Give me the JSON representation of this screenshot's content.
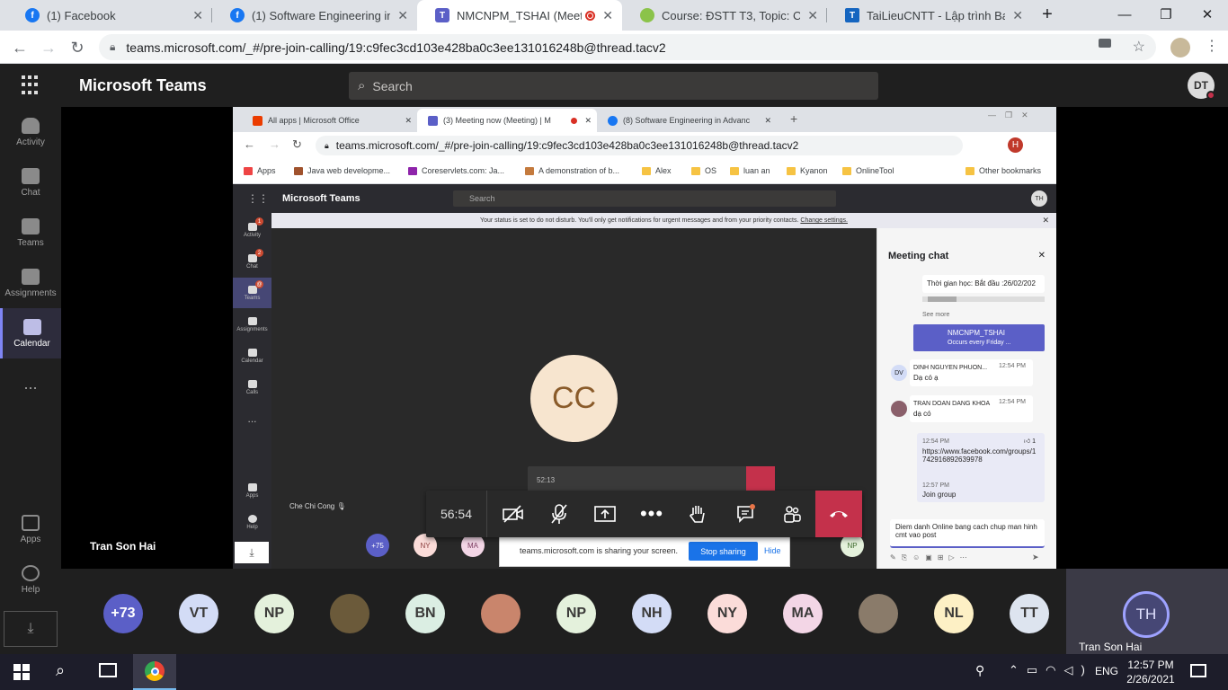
{
  "browser": {
    "tabs": [
      {
        "title": "(1) Facebook"
      },
      {
        "title": "(1) Software Engineering in Ad"
      },
      {
        "title": "NMCNPM_TSHAI (Meeting"
      },
      {
        "title": "Course: ĐSTT T3, Topic: CHUO"
      },
      {
        "title": "TaiLieuCNTT - Lập trình Backen"
      }
    ],
    "url": "teams.microsoft.com/_#/pre-join-calling/19:c9fec3cd103e428ba0c3ee131016248b@thread.tacv2"
  },
  "teams": {
    "app_title": "Microsoft Teams",
    "search_placeholder": "Search",
    "user_initials": "DT",
    "rail": [
      {
        "label": "Activity"
      },
      {
        "label": "Chat"
      },
      {
        "label": "Teams"
      },
      {
        "label": "Assignments"
      },
      {
        "label": "Calendar"
      },
      {
        "label": "..."
      }
    ],
    "rail_bottom": [
      {
        "label": "Apps"
      },
      {
        "label": "Help"
      }
    ],
    "presenter_name": "Tran Son Hai",
    "self_name": "Tran Son Hai",
    "self_initials": "TH"
  },
  "shared": {
    "tabs": [
      {
        "title": "All apps | Microsoft Office"
      },
      {
        "title": "(3) Meeting now (Meeting) | M"
      },
      {
        "title": "(8) Software Engineering in Advanc"
      }
    ],
    "url": "teams.microsoft.com/_#/pre-join-calling/19:c9fec3cd103e428ba0c3ee131016248b@thread.tacv2",
    "bookmarks": [
      "Apps",
      "Java web developme...",
      "Coreservlets.com: Ja...",
      "A demonstration of b...",
      "Alex",
      "OS",
      "luan an",
      "Kyanon",
      "OnlineTool"
    ],
    "other_bookmarks": "Other bookmarks",
    "app_title": "Microsoft Teams",
    "search": "Search",
    "user_initials": "TH",
    "profile_initial": "H",
    "rail": [
      {
        "label": "Activity",
        "badge": "1"
      },
      {
        "label": "Chat",
        "badge": "2"
      },
      {
        "label": "Teams",
        "badge": "@"
      },
      {
        "label": "Assignments",
        "badge": ""
      },
      {
        "label": "Calendar",
        "badge": ""
      },
      {
        "label": "Calls",
        "badge": ""
      },
      {
        "label": "...",
        "badge": ""
      }
    ],
    "rail_bottom": [
      {
        "label": "Apps"
      },
      {
        "label": "Help"
      }
    ],
    "dnd_text": "Your status is set to do not disturb. You'll only get notifications for urgent messages and from your priority contacts.",
    "dnd_link": "Change settings.",
    "speaker_initials": "CC",
    "speaker_name": "Che Chi Cong",
    "mini_timer": "52:13",
    "participant_count": "+75",
    "mini_participants": [
      "NY",
      "MA",
      "NP"
    ],
    "sharing_text": "teams.microsoft.com is sharing your screen.",
    "stop_sharing": "Stop sharing",
    "hide": "Hide",
    "chat": {
      "title": "Meeting chat",
      "schedule_text": "Thời gian học: Bắt đầu :26/02/202",
      "see_more": "See more",
      "event_title": "NMCNPM_TSHAI",
      "event_sub": "Occurs every Friday ...",
      "messages": [
        {
          "initials": "DV",
          "author": "DINH NGUYEN PHUON...",
          "time": "12:54 PM",
          "text": "Dạ có ạ"
        },
        {
          "initials": "",
          "author": "TRAN DOAN DANG KHOA",
          "time": "12:54 PM",
          "text": "dạ có"
        }
      ],
      "my_messages": [
        {
          "time": "12:54 PM",
          "reaction": "1",
          "text": "https://www.facebook.com/groups/1742916892639978"
        },
        {
          "time": "12:57 PM",
          "reaction": "",
          "text": "Join group"
        }
      ],
      "compose": "Diem danh Online bang cach chup man hinh cmt vao post"
    }
  },
  "callbar": {
    "timer": "56:54"
  },
  "participants": [
    {
      "initials": "+73",
      "color": "#5b5fc7"
    },
    {
      "initials": "VT",
      "color": "#d3dcf6"
    },
    {
      "initials": "NP",
      "color": "#e4f1dc"
    },
    {
      "initials": "",
      "color": "#6b5a3a"
    },
    {
      "initials": "BN",
      "color": "#dbeee3"
    },
    {
      "initials": "",
      "color": "#c9856c"
    },
    {
      "initials": "NP",
      "color": "#e4f1dc"
    },
    {
      "initials": "NH",
      "color": "#d3dcf6"
    },
    {
      "initials": "NY",
      "color": "#fbdcd9"
    },
    {
      "initials": "MA",
      "color": "#f3d6e6"
    },
    {
      "initials": "",
      "color": "#8a7b6a"
    },
    {
      "initials": "NL",
      "color": "#fdf0c5"
    },
    {
      "initials": "TT",
      "color": "#dde4ef"
    }
  ],
  "taskbar": {
    "language": "ENG",
    "time": "12:57 PM",
    "date": "2/26/2021"
  }
}
